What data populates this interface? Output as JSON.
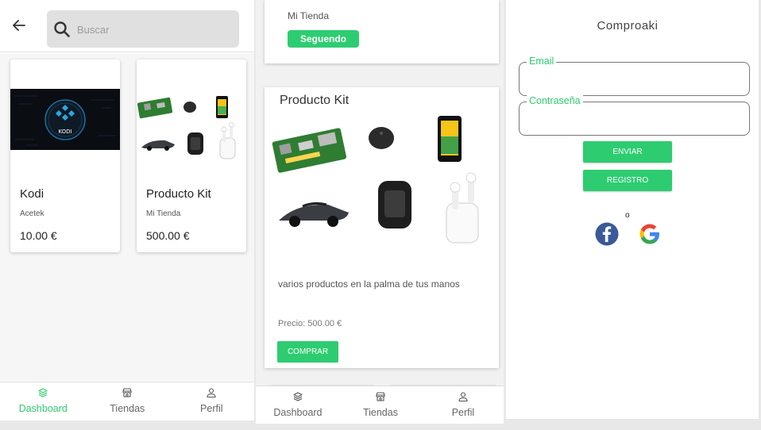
{
  "screen1": {
    "search": {
      "placeholder": "Buscar"
    },
    "products": [
      {
        "name": "Kodi",
        "store": "Acetek",
        "price": "10.00 €",
        "image": "kodi-logo-image"
      },
      {
        "name": "Producto Kit",
        "store": "Mi Tienda",
        "price": "500.00 €",
        "image": "gadgets-kit-image"
      }
    ],
    "nav": [
      {
        "label": "Dashboard",
        "icon": "layers-icon",
        "active": true
      },
      {
        "label": "Tiendas",
        "icon": "store-icon",
        "active": false
      },
      {
        "label": "Perfil",
        "icon": "user-icon",
        "active": false
      }
    ]
  },
  "screen2": {
    "store_name": "Mi Tienda",
    "follow_label": "Seguendo",
    "product": {
      "title": "Producto Kit",
      "description": "varios productos en la palma de tus manos",
      "price": "Precio: 500.00 €",
      "buy_label": "COMPRAR"
    },
    "nav": [
      {
        "label": "Dashboard",
        "icon": "layers-icon"
      },
      {
        "label": "Tiendas",
        "icon": "store-icon"
      },
      {
        "label": "Perfil",
        "icon": "user-icon"
      }
    ]
  },
  "screen3": {
    "app_title": "Comproaki",
    "email_label": "Email",
    "password_label": "Contraseña",
    "submit_label": "ENVIAR",
    "register_label": "REGISTRO",
    "or_text": "o",
    "social": [
      "facebook-icon",
      "google-icon"
    ]
  },
  "colors": {
    "accent": "#2ecc71",
    "facebook": "#3b5998"
  }
}
